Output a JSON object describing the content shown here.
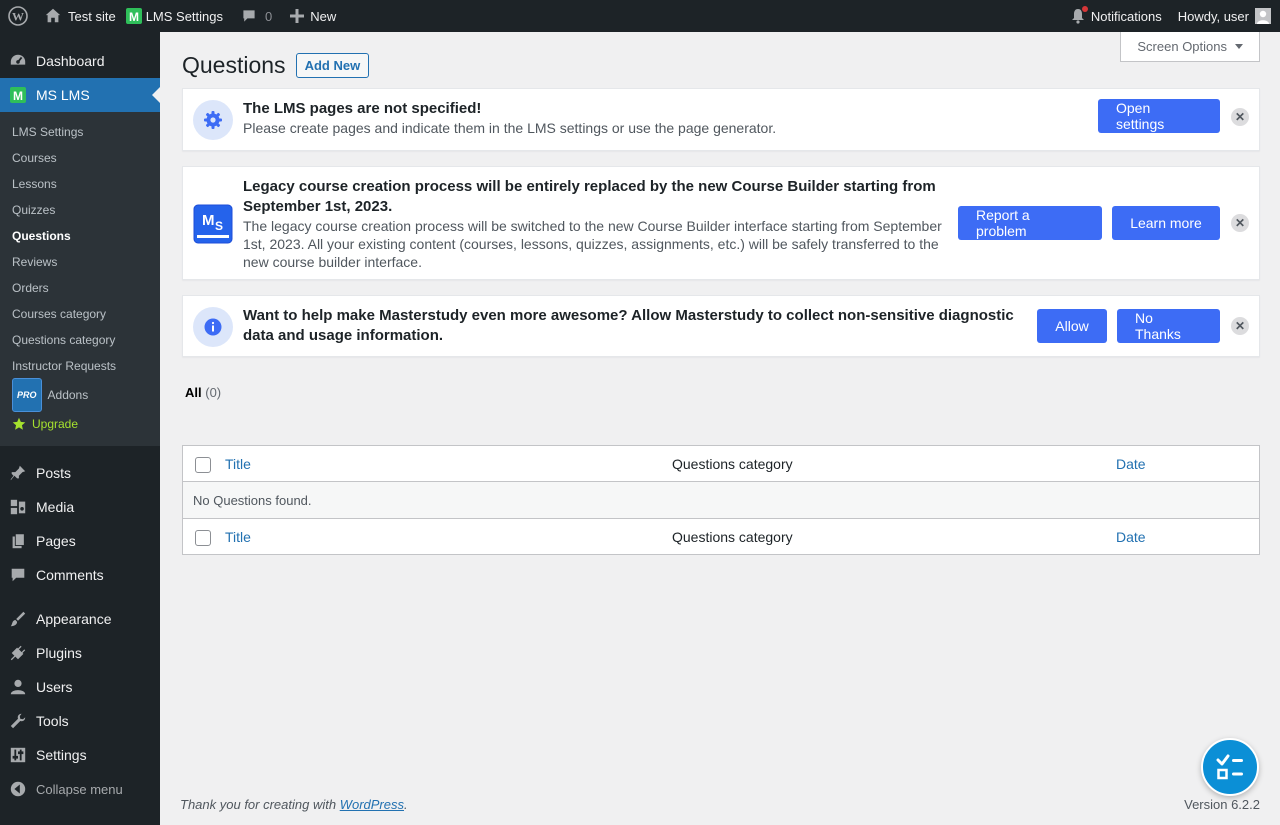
{
  "admin_bar": {
    "site_name": "Test site",
    "lms_settings": "LMS Settings",
    "comments_count": "0",
    "new_label": "New",
    "notifications": "Notifications",
    "howdy": "Howdy, user"
  },
  "sidebar": {
    "dashboard": "Dashboard",
    "ms_lms": "MS LMS",
    "lms_submenu": [
      "LMS Settings",
      "Courses",
      "Lessons",
      "Quizzes",
      "Questions",
      "Reviews",
      "Orders",
      "Courses category",
      "Questions category",
      "Instructor Requests"
    ],
    "pro_badge": "PRO",
    "addons": "Addons",
    "upgrade": "Upgrade",
    "menu": [
      "Posts",
      "Media",
      "Pages",
      "Comments",
      "Appearance",
      "Plugins",
      "Users",
      "Tools",
      "Settings"
    ],
    "collapse": "Collapse menu"
  },
  "header": {
    "screen_options": "Screen Options",
    "title": "Questions",
    "add_new": "Add New"
  },
  "notices": {
    "pages": {
      "title": "The LMS pages are not specified!",
      "desc": "Please create pages and indicate them in the LMS settings or use the page generator.",
      "button": "Open settings"
    },
    "legacy": {
      "title": "Legacy course creation process will be entirely replaced by the new Course Builder starting from September 1st, 2023.",
      "desc": "The legacy course creation process will be switched to the new Course Builder interface starting from September 1st, 2023. All your existing content (courses, lessons, quizzes, assignments, etc.) will be safely transferred to the new course builder interface.",
      "report": "Report a problem",
      "learn": "Learn more"
    },
    "diagnostic": {
      "title": "Want to help make Masterstudy even more awesome? Allow Masterstudy to collect non-sensitive diagnostic data and usage information.",
      "allow": "Allow",
      "no_thanks": "No Thanks"
    }
  },
  "filters": {
    "all": "All",
    "all_count": "(0)"
  },
  "table": {
    "columns": [
      "Title",
      "Questions category",
      "Date"
    ],
    "empty": "No Questions found."
  },
  "footer": {
    "thanks_pre": "Thank you for creating with",
    "wordpress": "WordPress",
    "thanks_post": ".",
    "version": "Version 6.2.2"
  },
  "colors": {
    "accent_blue": "#3d6cf5",
    "wp_blue": "#2271b1",
    "sidebar_bg": "#1d2327",
    "fab": "#0b8fd6"
  }
}
